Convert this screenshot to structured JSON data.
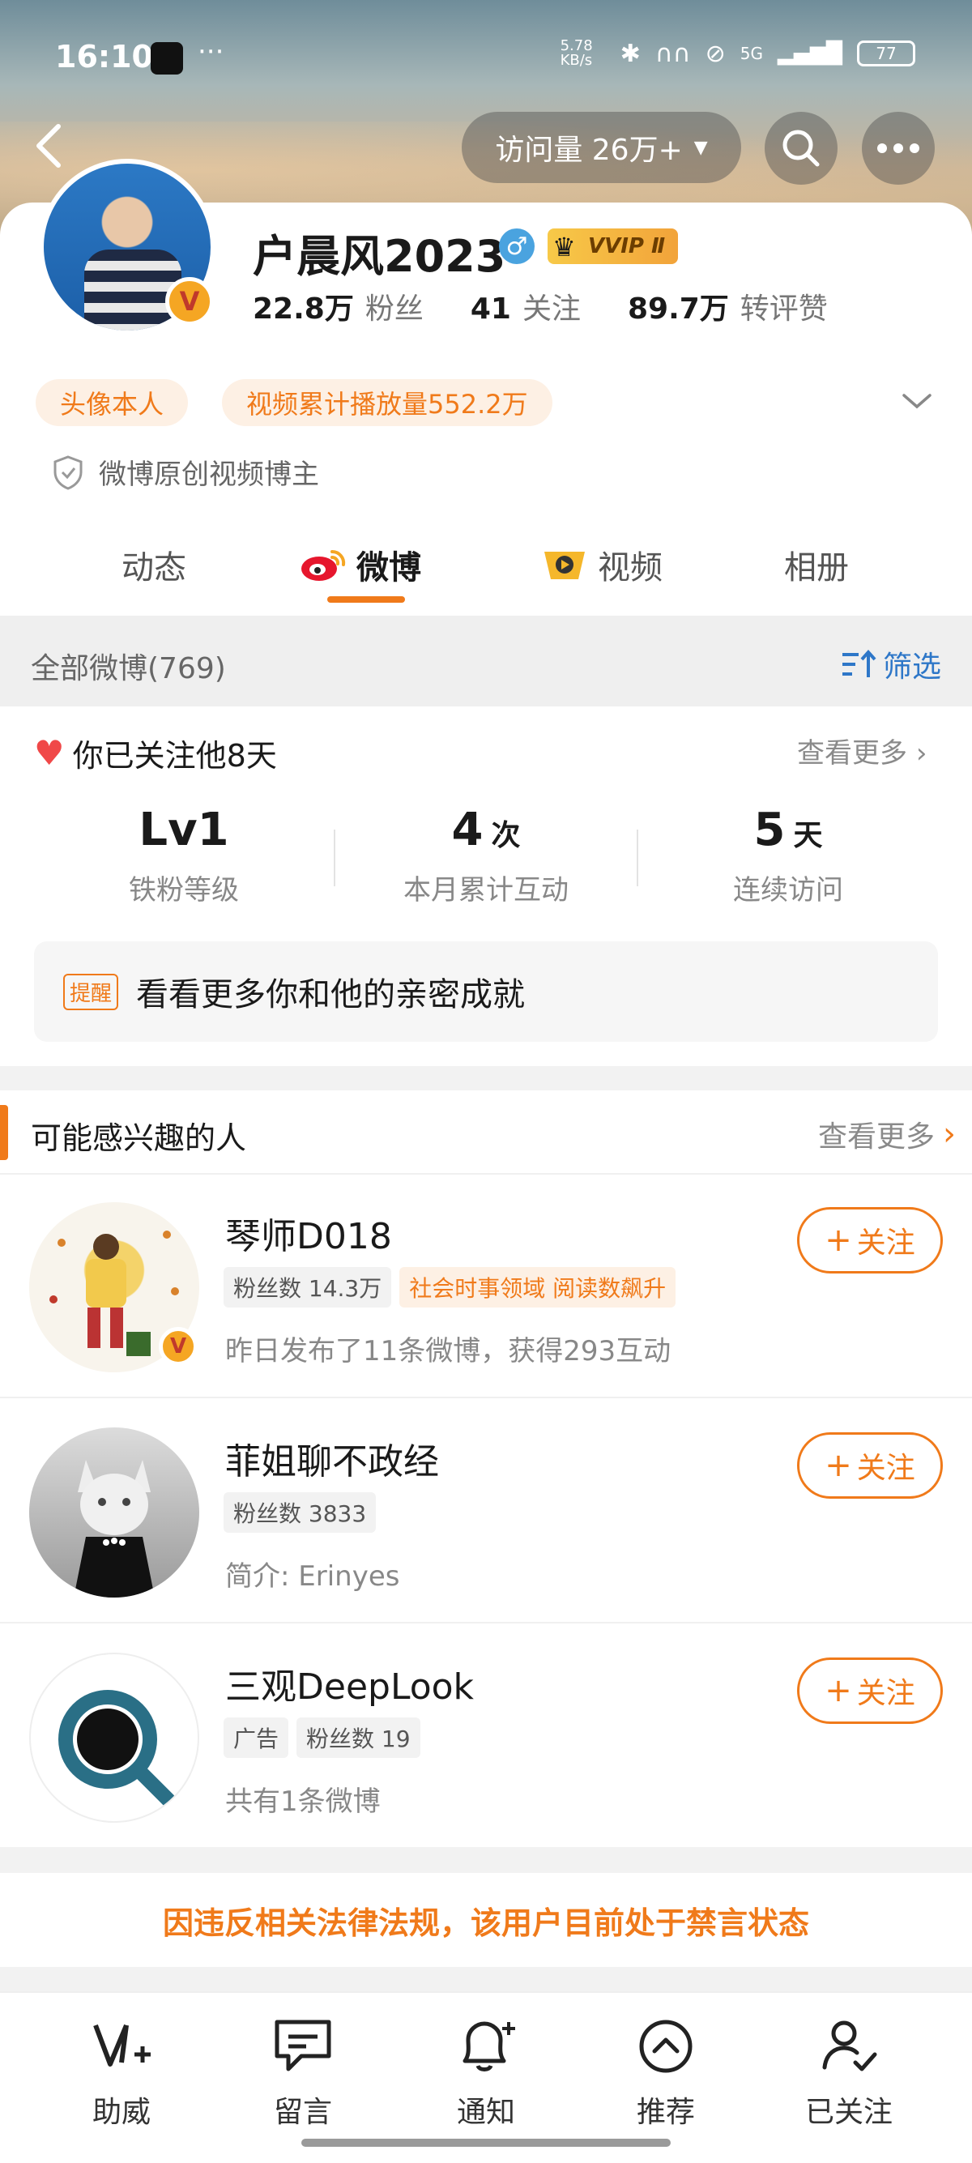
{
  "status_bar": {
    "time": "16:10",
    "dots": "···",
    "net_speed": "5.78 KB/s",
    "network": "5G",
    "battery": "77"
  },
  "header": {
    "visits_label": "访问量 26万+"
  },
  "profile": {
    "name": "户晨风2023",
    "vvip": "VVIP Ⅱ",
    "stats": [
      {
        "num": "22.8万",
        "label": "粉丝"
      },
      {
        "num": "41",
        "label": "关注"
      },
      {
        "num": "89.7万",
        "label": "转评赞"
      }
    ],
    "tags": [
      "头像本人",
      "视频累计播放量552.2万"
    ],
    "verified": "微博原创视频博主"
  },
  "tabs": [
    {
      "label": "动态"
    },
    {
      "label": "微博"
    },
    {
      "label": "视频"
    },
    {
      "label": "相册"
    }
  ],
  "all_weibo": {
    "label": "全部微博(769)",
    "filter_label": "筛选"
  },
  "follow_info": {
    "title": "你已关注他8天",
    "see_more": "查看更多",
    "metrics": [
      {
        "value": "Lv1",
        "unit": "",
        "label": "铁粉等级"
      },
      {
        "value": "4",
        "unit": "次",
        "label": "本月累计互动"
      },
      {
        "value": "5",
        "unit": "天",
        "label": "连续访问"
      }
    ],
    "reminder_tag": "提醒",
    "reminder_text": "看看更多你和他的亲密成就"
  },
  "suggestions": {
    "title": "可能感兴趣的人",
    "see_more": "查看更多",
    "follow_label": "关注",
    "people": [
      {
        "name": "琴师D018",
        "chips": [
          "粉丝数 14.3万",
          "社会时事领域 阅读数飙升"
        ],
        "desc": "昨日发布了11条微博，获得293互动"
      },
      {
        "name": "菲姐聊不政经",
        "chips": [
          "粉丝数 3833"
        ],
        "desc": "简介: Erinyes"
      },
      {
        "name": "三观DeepLook",
        "chips": [
          "广告",
          "粉丝数 19"
        ],
        "desc": "共有1条微博"
      }
    ]
  },
  "banned_notice": "因违反相关法律法规，该用户目前处于禁言状态",
  "bottom_bar": [
    {
      "label": "助威"
    },
    {
      "label": "留言"
    },
    {
      "label": "通知"
    },
    {
      "label": "推荐"
    },
    {
      "label": "已关注"
    }
  ],
  "colors": {
    "accent": "#f07a1a",
    "link": "#2e77c8"
  }
}
